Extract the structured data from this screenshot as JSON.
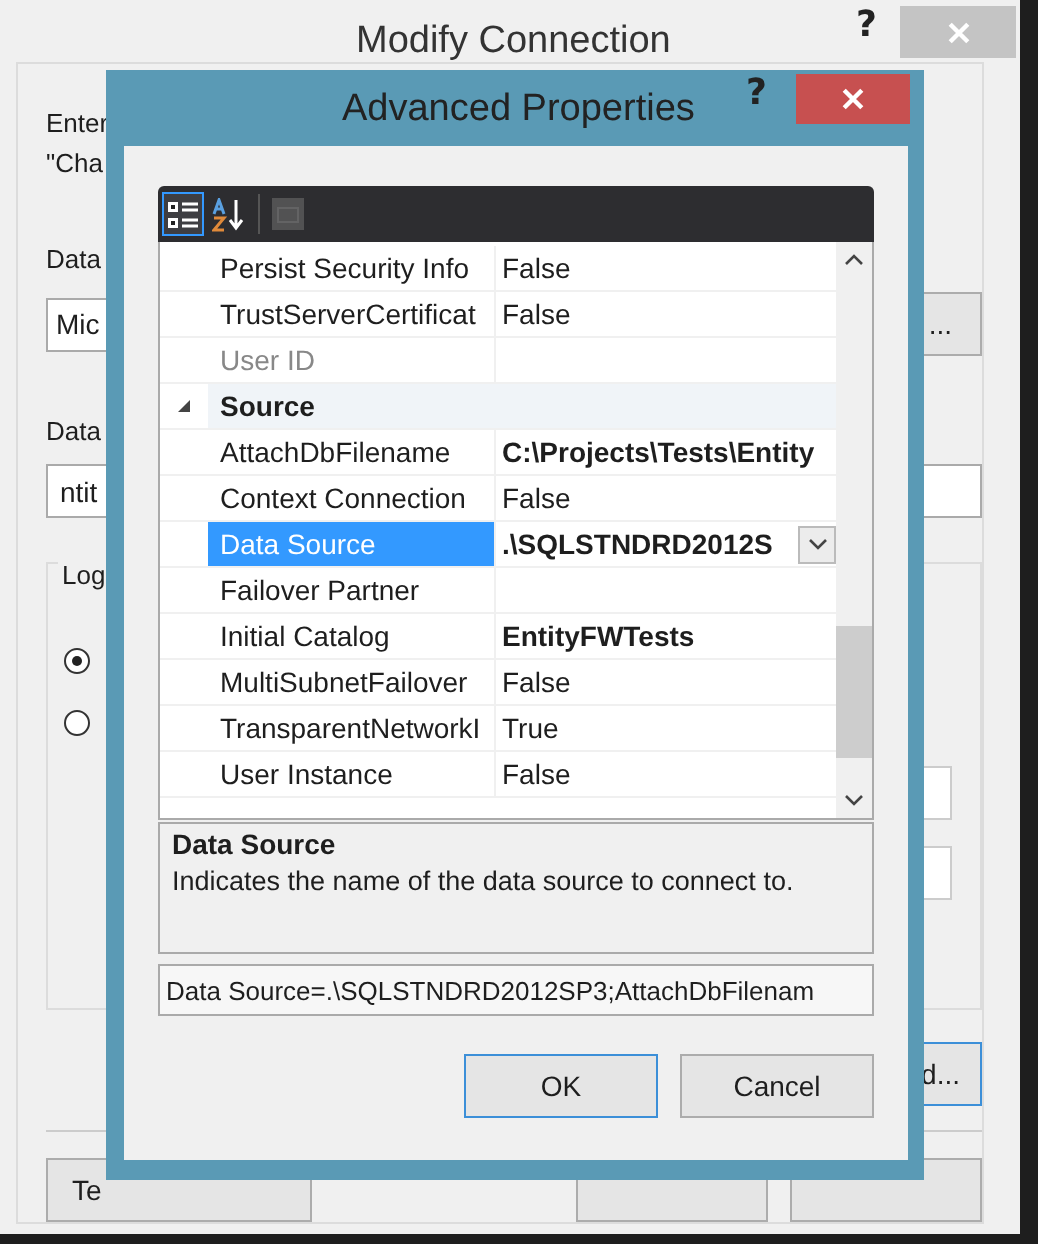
{
  "back_window": {
    "title": "Modify Connection",
    "help_button": "?",
    "intro_lines": [
      "Enter",
      "\"Cha"
    ],
    "data_source_label": "Data",
    "data_source_value": "Mic",
    "change_button": "...",
    "database_label": "Data",
    "database_value": "ntit",
    "logon_group": {
      "label": "Log",
      "options": [
        {
          "selected": true
        },
        {
          "selected": false
        }
      ]
    },
    "advanced_button": "d...",
    "test_button": "Te"
  },
  "dialog": {
    "title": "Advanced Properties",
    "help_button": "?",
    "toolbar": [
      {
        "kind": "categorized",
        "selected": true,
        "disabled": false
      },
      {
        "kind": "alphabetical",
        "selected": false,
        "disabled": false
      },
      {
        "kind": "property_pages",
        "selected": false,
        "disabled": true
      }
    ],
    "grid": [
      {
        "kind": "property",
        "name": "Persist Security Info",
        "value": "False",
        "modified": false,
        "readonly": false,
        "selected": false
      },
      {
        "kind": "property",
        "name": "TrustServerCertificat",
        "value": "False",
        "modified": false,
        "readonly": false,
        "selected": false
      },
      {
        "kind": "property",
        "name": "User ID",
        "readonly": true,
        "selected": false
      },
      {
        "kind": "category",
        "name": "Source",
        "expanded": true
      },
      {
        "kind": "property",
        "name": "AttachDbFilename",
        "value": "C:\\Projects\\Tests\\Entity",
        "modified": true,
        "readonly": false,
        "selected": false
      },
      {
        "kind": "property",
        "name": "Context Connection",
        "value": "False",
        "modified": false,
        "readonly": false,
        "selected": false
      },
      {
        "kind": "property",
        "name": "Data Source",
        "value": ".\\SQLSTNDRD2012S",
        "modified": true,
        "readonly": false,
        "selected": true
      },
      {
        "kind": "property",
        "name": "Failover Partner",
        "readonly": false,
        "selected": false
      },
      {
        "kind": "property",
        "name": "Initial Catalog",
        "value": "EntityFWTests",
        "modified": true,
        "readonly": false,
        "selected": false
      },
      {
        "kind": "property",
        "name": "MultiSubnetFailover",
        "value": "False",
        "modified": false,
        "readonly": false,
        "selected": false
      },
      {
        "kind": "property",
        "name": "TransparentNetworkI",
        "value": "True",
        "modified": false,
        "readonly": false,
        "selected": false
      },
      {
        "kind": "property",
        "name": "User Instance",
        "value": "False",
        "modified": false,
        "readonly": false,
        "selected": false
      }
    ],
    "description": {
      "title": "Data Source",
      "text": "Indicates the name of the data source to connect to."
    },
    "connection_string": "Data Source=.\\SQLSTNDRD2012SP3;AttachDbFilenam",
    "buttons": [
      {
        "label": "OK",
        "default": true
      },
      {
        "label": "Cancel",
        "default": false
      }
    ]
  }
}
